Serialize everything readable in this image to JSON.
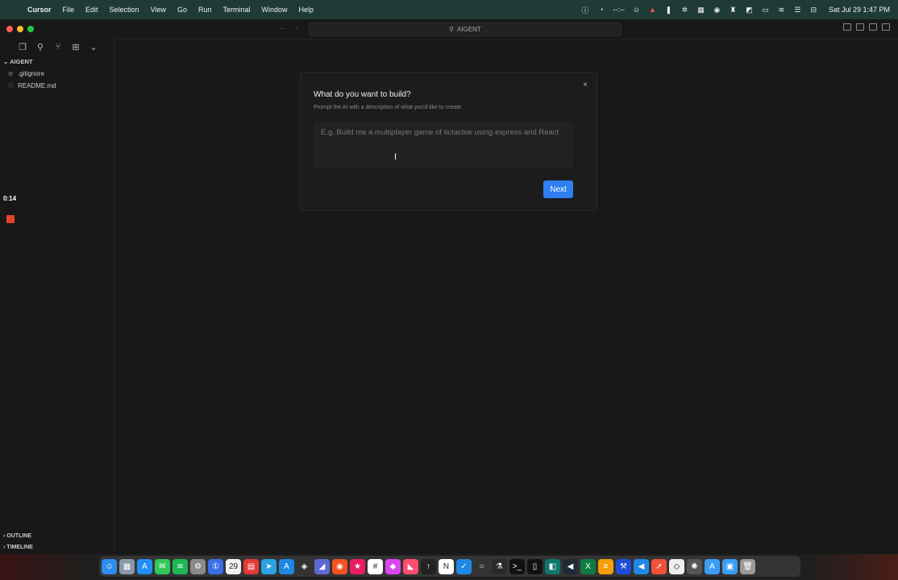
{
  "menubar": {
    "app_name": "Cursor",
    "menus": [
      "File",
      "Edit",
      "Selection",
      "View",
      "Go",
      "Run",
      "Terminal",
      "Window",
      "Help"
    ],
    "battery_text": "--:--",
    "clock": "Sat Jul 29  1:47 PM"
  },
  "titlebar": {
    "workspace": "AIGENT"
  },
  "sidebar": {
    "section_title": "AIGENT",
    "files": [
      ".gitignore",
      "README.md"
    ],
    "outline_label": "OUTLINE",
    "timeline_label": "TIMELINE"
  },
  "recorder": {
    "elapsed": "0:14"
  },
  "dialog": {
    "title": "What do you want to build?",
    "subtitle": "Prompt the AI with a description of what you'd like to create",
    "placeholder": "E.g. Build me a multiplayer game of tictactoe using express and React",
    "next_label": "Next",
    "close_glyph": "×"
  },
  "dock": {
    "apps": [
      {
        "name": "finder",
        "color": "#2d8cf0",
        "glyph": "☺"
      },
      {
        "name": "launchpad",
        "color": "#8899aa",
        "glyph": "▦"
      },
      {
        "name": "app-store",
        "color": "#1f8ff7",
        "glyph": "A"
      },
      {
        "name": "messages",
        "color": "#34c759",
        "glyph": "✉"
      },
      {
        "name": "spotify",
        "color": "#1db954",
        "glyph": "≋"
      },
      {
        "name": "system-settings",
        "color": "#8a8a8a",
        "glyph": "⚙"
      },
      {
        "name": "1password",
        "color": "#3b6ee6",
        "glyph": "①"
      },
      {
        "name": "calendar",
        "color": "#f2f2f2",
        "glyph": "29"
      },
      {
        "name": "fantastical",
        "color": "#e53935",
        "glyph": "▤"
      },
      {
        "name": "telegram",
        "color": "#2aa3e0",
        "glyph": "➤"
      },
      {
        "name": "testflight",
        "color": "#1e88e5",
        "glyph": "A"
      },
      {
        "name": "layers",
        "color": "#333",
        "glyph": "◈"
      },
      {
        "name": "linear",
        "color": "#5e6ad2",
        "glyph": "◢"
      },
      {
        "name": "reeder",
        "color": "#f4511e",
        "glyph": "◉"
      },
      {
        "name": "craft",
        "color": "#e91e63",
        "glyph": "★"
      },
      {
        "name": "slack",
        "color": "#ffffff",
        "glyph": "#"
      },
      {
        "name": "shortcuts",
        "color": "#d946ef",
        "glyph": "◆"
      },
      {
        "name": "raycast",
        "color": "#ff4d6d",
        "glyph": "◣"
      },
      {
        "name": "arc",
        "color": "#222",
        "glyph": "↑"
      },
      {
        "name": "notion",
        "color": "#ffffff",
        "glyph": "N"
      },
      {
        "name": "things",
        "color": "#1e88e5",
        "glyph": "✓"
      },
      {
        "name": "chatgpt",
        "color": "#333",
        "glyph": "○"
      },
      {
        "name": "lab",
        "color": "#2a2a2a",
        "glyph": "⚗"
      },
      {
        "name": "terminal",
        "color": "#111",
        "glyph": ">_"
      },
      {
        "name": "cursor",
        "color": "#111",
        "glyph": "▯"
      },
      {
        "name": "copilot",
        "color": "#0f766e",
        "glyph": "◧"
      },
      {
        "name": "vscode-insiders",
        "color": "#1f2937",
        "glyph": "◀"
      },
      {
        "name": "excel",
        "color": "#107c41",
        "glyph": "X"
      },
      {
        "name": "sublime",
        "color": "#f59e0b",
        "glyph": "≡"
      },
      {
        "name": "xcode",
        "color": "#1d4ed8",
        "glyph": "⚒"
      },
      {
        "name": "vscode",
        "color": "#1e88e5",
        "glyph": "◀"
      },
      {
        "name": "swift",
        "color": "#f05138",
        "glyph": "➚"
      },
      {
        "name": "unity",
        "color": "#eee",
        "glyph": "◇"
      },
      {
        "name": "chatgpt-alt",
        "color": "#555",
        "glyph": "✺"
      },
      {
        "name": "applications-folder",
        "color": "#3b9df5",
        "glyph": "A"
      },
      {
        "name": "downloads-folder",
        "color": "#3b9df5",
        "glyph": "▣"
      },
      {
        "name": "trash",
        "color": "#999",
        "glyph": "🗑"
      }
    ]
  }
}
